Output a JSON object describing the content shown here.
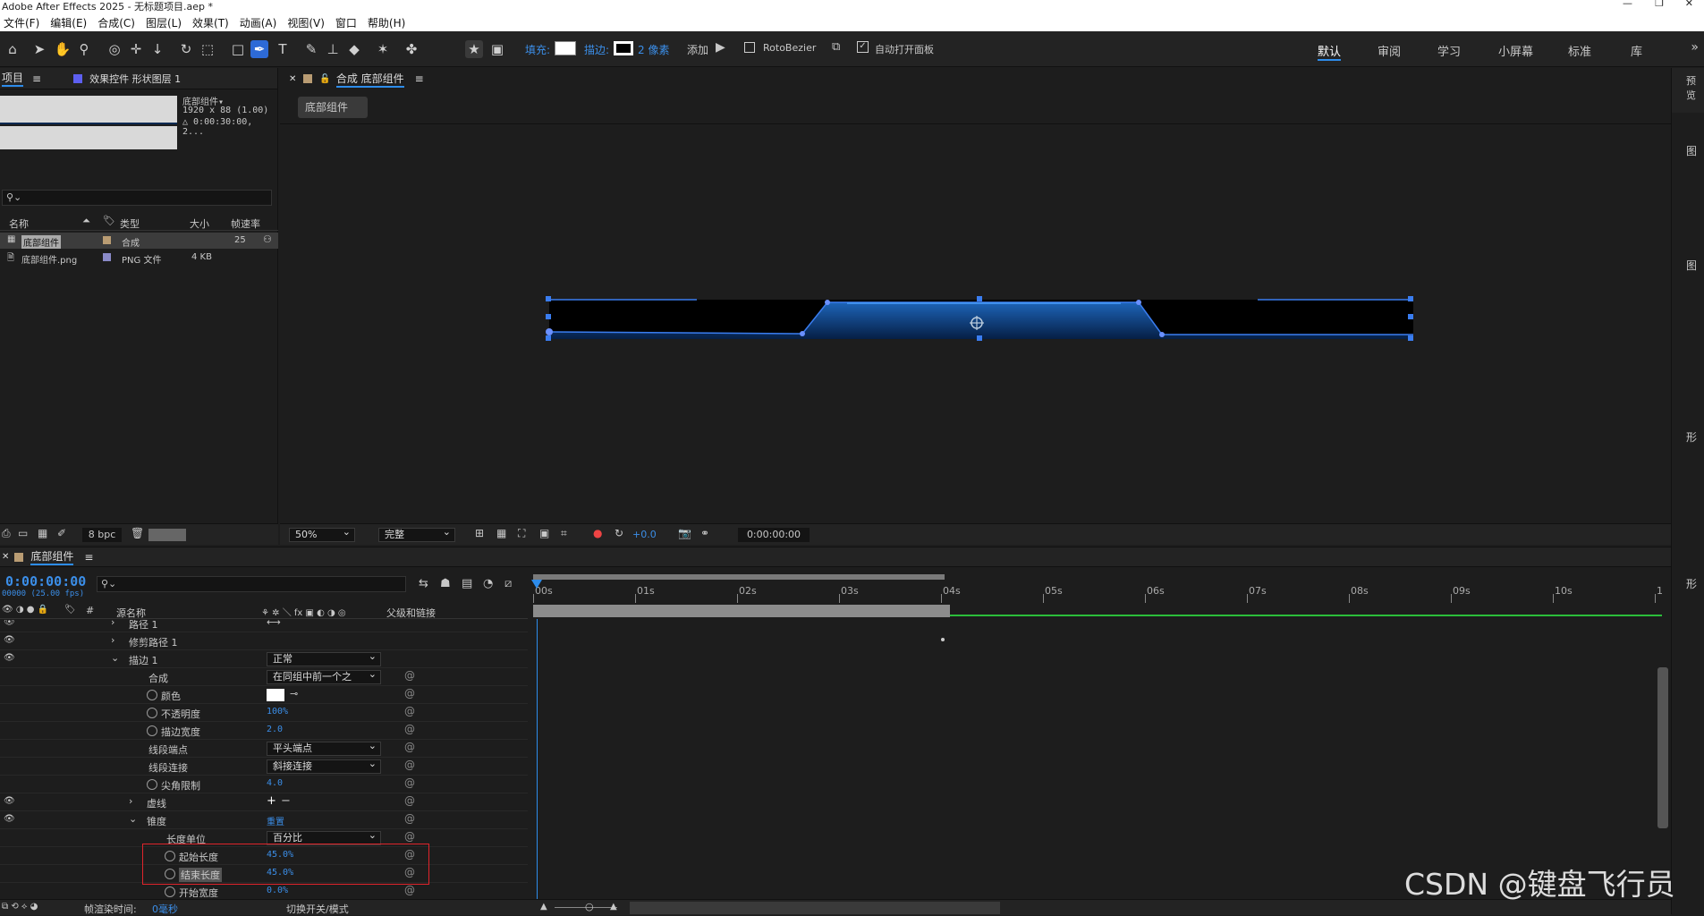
{
  "app": {
    "title": "Adobe After Effects 2025 - 无标题项目.aep *"
  },
  "menu": [
    "文件(F)",
    "编辑(E)",
    "合成(C)",
    "图层(L)",
    "效果(T)",
    "动画(A)",
    "视图(V)",
    "窗口",
    "帮助(H)"
  ],
  "toolbar": {
    "fill_label": "填充:",
    "stroke_label": "描边:",
    "stroke_px": "2 像素",
    "add_label": "添加",
    "rotobezier": "RotoBezier",
    "auto_open": "自动打开面板"
  },
  "workspaces": [
    "默认",
    "审阅",
    "学习",
    "小屏幕",
    "标准",
    "库"
  ],
  "project": {
    "tab": "项目",
    "effects_tab": "效果控件 形状图层 1",
    "comp_name": "底部组件▾",
    "comp_dims": "1920 x 88 (1.00)",
    "comp_duration": "△ 0:00:30:00, 2...",
    "cols": [
      "名称",
      "类型",
      "大小",
      "帧速率"
    ],
    "items": [
      {
        "name": "底部组件",
        "type": "合成",
        "size": "",
        "fps": "25"
      },
      {
        "name": "底部组件.png",
        "type": "PNG 文件",
        "size": "4 KB",
        "fps": ""
      }
    ],
    "bpc": "8 bpc"
  },
  "comp": {
    "tab": "合成 底部组件",
    "subtab": "底部组件",
    "zoom": "50%",
    "quality": "完整",
    "exposure": "+0.0",
    "timecode": "0:00:00:00"
  },
  "timeline": {
    "tab": "底部组件",
    "time": "0:00:00:00",
    "fps_note": "00000 (25.00 fps)",
    "col_source": "源名称",
    "col_parent": "父级和链接",
    "ticks": [
      "00s",
      "01s",
      "02s",
      "03s",
      "04s",
      "05s",
      "06s",
      "07s",
      "08s",
      "09s",
      "10s",
      "1"
    ],
    "layers": [
      {
        "name": "路径 1",
        "indent": 0
      },
      {
        "name": "修剪路径 1",
        "indent": 0
      },
      {
        "name": "描边 1",
        "indent": 0,
        "value": "正常",
        "dropdown": true
      },
      {
        "name": "合成",
        "indent": 1,
        "value": "在同组中前一个之",
        "dropdown": true
      },
      {
        "name": "颜色",
        "indent": 1
      },
      {
        "name": "不透明度",
        "indent": 1,
        "value": "100%"
      },
      {
        "name": "描边宽度",
        "indent": 1,
        "value": "2.0"
      },
      {
        "name": "线段端点",
        "indent": 1,
        "value": "平头端点",
        "dropdown": true
      },
      {
        "name": "线段连接",
        "indent": 1,
        "value": "斜接连接",
        "dropdown": true
      },
      {
        "name": "尖角限制",
        "indent": 1,
        "value": "4.0"
      },
      {
        "name": "虚线",
        "indent": 1
      },
      {
        "name": "锥度",
        "indent": 1,
        "value": "重置"
      },
      {
        "name": "长度单位",
        "indent": 2,
        "value": "百分比",
        "dropdown": true
      },
      {
        "name": "起始长度",
        "indent": 2,
        "value": "45.0%"
      },
      {
        "name": "结束长度",
        "indent": 2,
        "value": "45.0%"
      },
      {
        "name": "开始宽度",
        "indent": 2,
        "value": "0.0%"
      }
    ],
    "render_time_label": "帧渲染时间:",
    "render_time": "0毫秒",
    "toggle_label": "切换开关/模式"
  },
  "right_panel": {
    "labels": [
      "预览",
      "图",
      "图",
      "形",
      "形"
    ]
  },
  "watermark": "CSDN @键盘飞行员",
  "colors": {
    "accent": "#2d8ceb",
    "shape": "#0e3a72",
    "highlight": "#e0242b"
  }
}
